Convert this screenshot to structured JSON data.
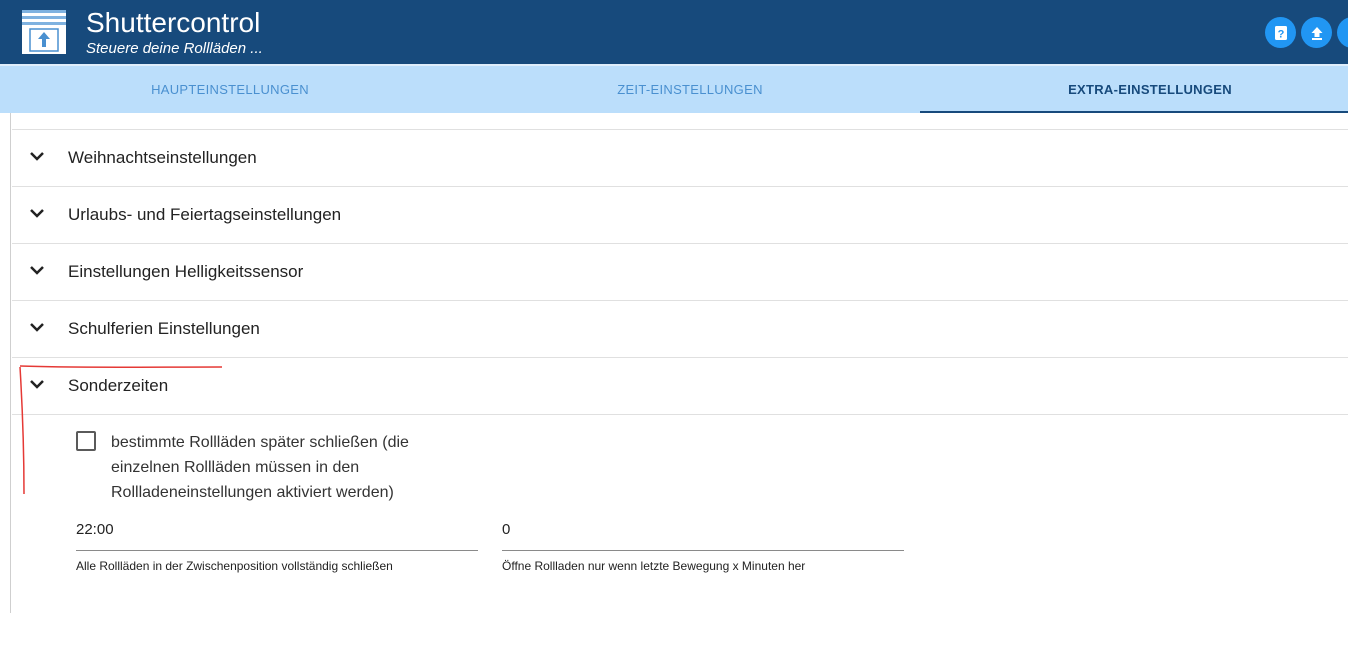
{
  "header": {
    "title": "Shuttercontrol",
    "subtitle": "Steuere deine Rollläden ...",
    "buttons": [
      {
        "icon": "help-icon"
      },
      {
        "icon": "upload-icon"
      },
      {
        "icon": "close-icon"
      }
    ]
  },
  "tabs": [
    {
      "label": "HAUPTEINSTELLUNGEN",
      "active": false
    },
    {
      "label": "ZEIT-EINSTELLUNGEN",
      "active": false
    },
    {
      "label": "EXTRA-EINSTELLUNGEN",
      "active": true
    }
  ],
  "panels": [
    {
      "label": "Weihnachtseinstellungen"
    },
    {
      "label": "Urlaubs- und Feiertagseinstellungen"
    },
    {
      "label": "Einstellungen Helligkeitssensor"
    },
    {
      "label": "Schulferien Einstellungen"
    },
    {
      "label": "Sonderzeiten"
    }
  ],
  "sonderzeiten": {
    "checkbox_label": "bestimmte Rollläden später schließen (die einzelnen Rollläden müssen in den Rollladeneinstellungen aktiviert werden)",
    "checked": false,
    "field_time": {
      "value": "22:00",
      "help": "Alle Rollläden in der Zwischenposition vollständig schließen"
    },
    "field_minutes": {
      "value": "0",
      "help": "Öffne Rollladen nur wenn letzte Bewegung x Minuten her"
    }
  },
  "colors": {
    "header": "#174a7c",
    "tabbar": "#bbdefb",
    "accent": "#2196f3",
    "annotation": "#e53935"
  }
}
